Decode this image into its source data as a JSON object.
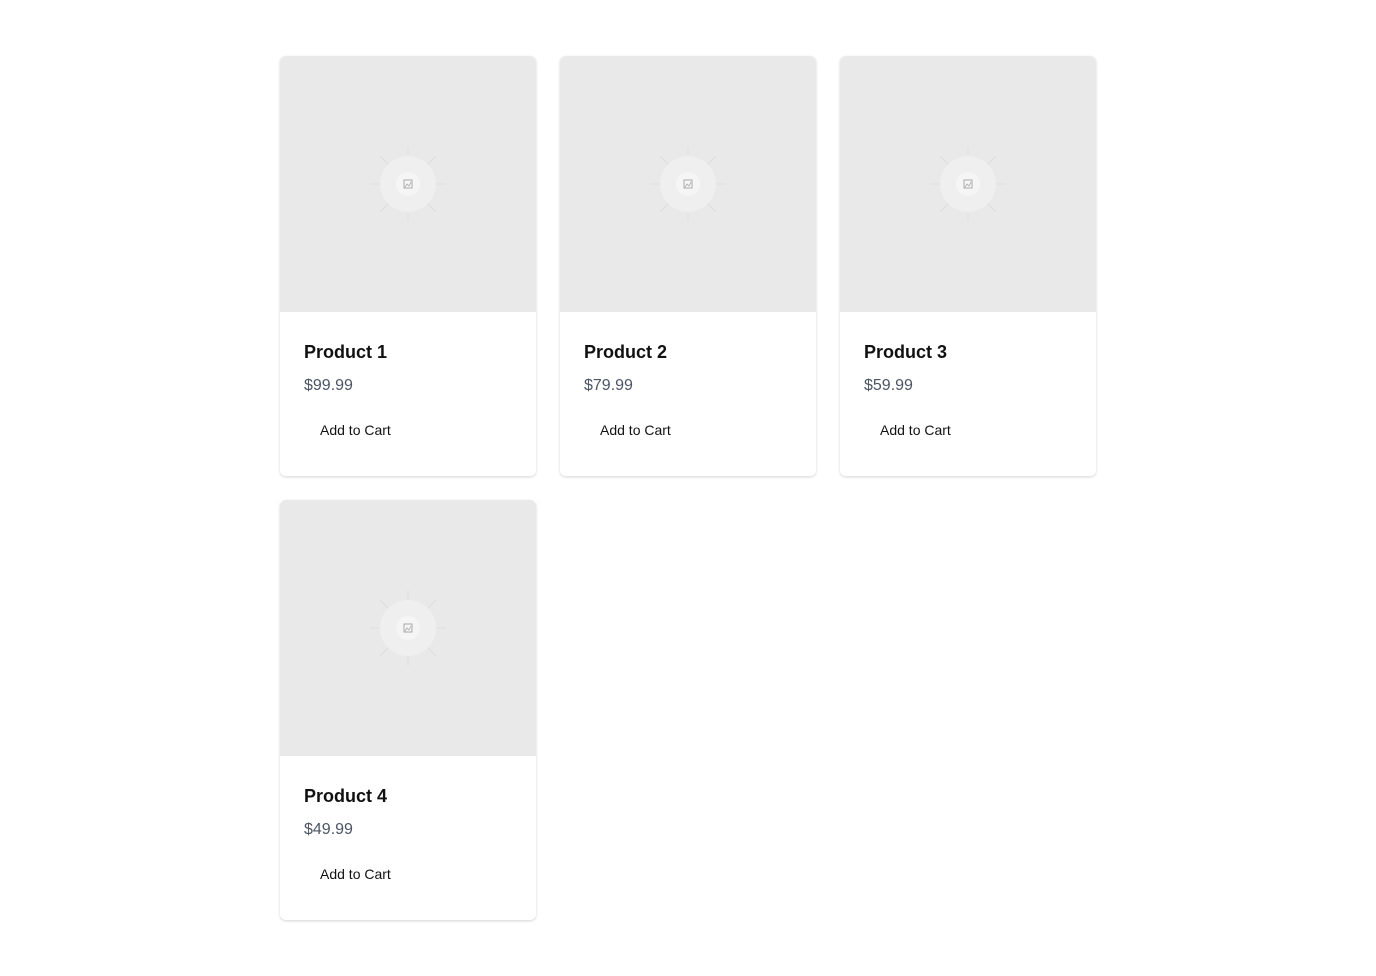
{
  "products": [
    {
      "name": "Product 1",
      "price": "$99.99",
      "button_label": "Add to Cart",
      "image_icon": "image-placeholder-icon"
    },
    {
      "name": "Product 2",
      "price": "$79.99",
      "button_label": "Add to Cart",
      "image_icon": "image-placeholder-icon"
    },
    {
      "name": "Product 3",
      "price": "$59.99",
      "button_label": "Add to Cart",
      "image_icon": "image-placeholder-icon"
    },
    {
      "name": "Product 4",
      "price": "$49.99",
      "button_label": "Add to Cart",
      "image_icon": "image-placeholder-icon"
    }
  ],
  "colors": {
    "placeholder_bg": "#e9e9e9",
    "price_text": "#4b5563",
    "title_text": "#111111"
  }
}
